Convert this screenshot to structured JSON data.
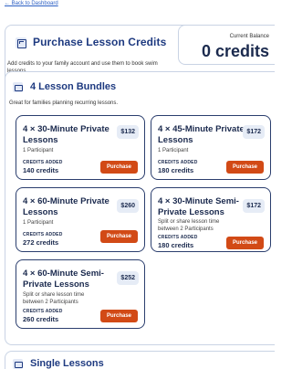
{
  "back_link": "← Back to Dashboard",
  "header": {
    "title": "Purchase Lesson Credits",
    "description": "Add credits to your family account and use them to book swim lessons.",
    "balance_label": "Current Balance",
    "balance_value": "0 credits"
  },
  "bundles": {
    "title": "4 Lesson Bundles",
    "description": "Great for families planning recurring lessons.",
    "credits_added_label": "CREDITS ADDED",
    "purchase_label": "Purchase",
    "cards": [
      {
        "title": "4 × 30-Minute Private Lessons",
        "subtitle": "1 Participant",
        "price": "$132",
        "credits": "140 credits"
      },
      {
        "title": "4 × 45-Minute Private Lessons",
        "subtitle": "1 Participant",
        "price": "$172",
        "credits": "180 credits"
      },
      {
        "title": "4 × 60-Minute Private Lessons",
        "subtitle": "1 Participant",
        "price": "$260",
        "credits": "272 credits"
      },
      {
        "title": "4 × 30-Minute Semi-Private Lessons",
        "subtitle": "Split or share lesson time between 2 Participants",
        "price": "$172",
        "credits": "180 credits"
      },
      {
        "title": "4 × 60-Minute Semi-Private Lessons",
        "subtitle": "Split or share lesson time between 2 Participants",
        "price": "$252",
        "credits": "260 credits"
      }
    ]
  },
  "single": {
    "title": "Single Lessons"
  }
}
